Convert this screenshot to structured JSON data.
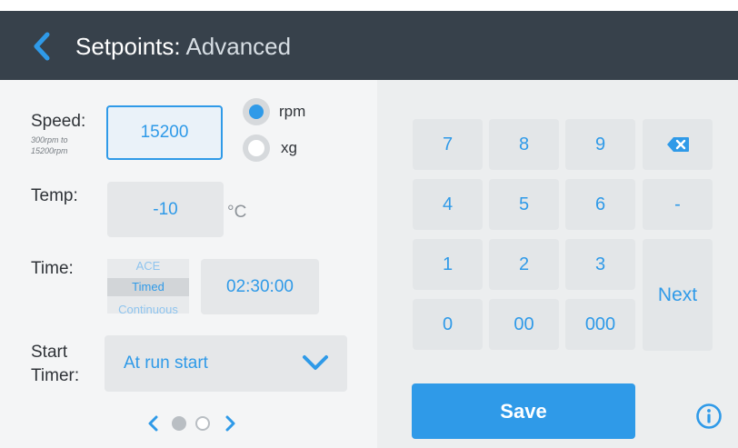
{
  "header": {
    "title_main": "Setpoints:",
    "title_sub": "Advanced"
  },
  "speed": {
    "label": "Speed:",
    "range_line1": "300rpm to",
    "range_line2": "15200rpm",
    "value": "15200",
    "unit_options": [
      {
        "label": "rpm",
        "selected": true
      },
      {
        "label": "xg",
        "selected": false
      }
    ]
  },
  "temp": {
    "label": "Temp:",
    "value": "-10",
    "unit": "°C"
  },
  "time": {
    "label": "Time:",
    "modes": [
      "ACE",
      "Timed",
      "Continuous"
    ],
    "selected_mode": "Timed",
    "value": "02:30:00"
  },
  "start_timer": {
    "label_line1": "Start",
    "label_line2": "Timer:",
    "value": "At run start"
  },
  "pager": {
    "current_page": 1,
    "total_pages": 2
  },
  "keypad": {
    "rows": [
      [
        "7",
        "8",
        "9"
      ],
      [
        "4",
        "5",
        "6"
      ],
      [
        "1",
        "2",
        "3"
      ],
      [
        "0",
        "00",
        "000"
      ]
    ],
    "minus": "-",
    "next": "Next"
  },
  "save_label": "Save",
  "colors": {
    "accent": "#2f9ae8",
    "header_bg": "#37414b",
    "key_bg": "#e3e6e8"
  }
}
